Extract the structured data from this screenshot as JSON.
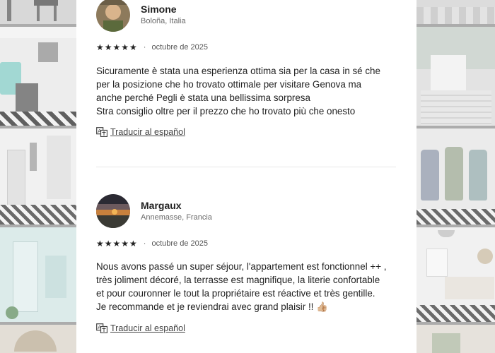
{
  "reviews": [
    {
      "name": "Simone",
      "location": "Boloña, Italia",
      "stars": "★★★★★",
      "separator": "·",
      "date": "octubre de 2025",
      "lines": [
        "Sicuramente è stata una esperienza ottima sia per la casa in sé che",
        "per la posizione che ho trovato ottimale per visitare Genova ma",
        "anche perché Pegli è stata una bellissima sorpresa",
        "Stra consiglio oltre per il prezzo che ho trovato più che onesto"
      ],
      "translate_label": "Traducir al español"
    },
    {
      "name": "Margaux",
      "location": "Annemasse, Francia",
      "stars": "★★★★★",
      "separator": "·",
      "date": "octubre de 2025",
      "lines": [
        "Nous avons passé un super séjour, l'appartement est fonctionnel ++ ,",
        "très joliment décoré, la terrasse est magnifique, la literie confortable",
        "et pour couronner le tout la propriétaire est réactive et très gentille.",
        "Je recommande et je reviendrai avec grand plaisir !! 👍🏼"
      ],
      "translate_label": "Traducir al español"
    }
  ],
  "icons": {
    "rating": "star-icon",
    "translate": "translate-icon"
  },
  "colors": {
    "text": "#222222",
    "muted": "#6a6a6a",
    "panel": "#ffffff",
    "overlay": "#8d8d8d"
  }
}
